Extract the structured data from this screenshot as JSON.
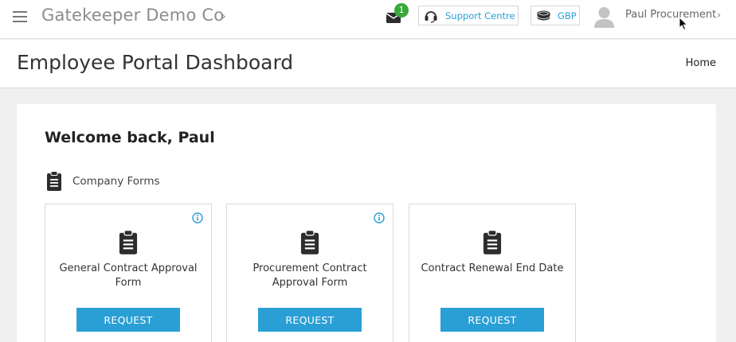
{
  "topbar": {
    "company": "Gatekeeper Demo Co",
    "notification_count": "1",
    "support_label": "Support Centre",
    "currency": "GBP",
    "user_name": "Paul Procurement"
  },
  "page": {
    "title": "Employee Portal Dashboard",
    "breadcrumb_home": "Home"
  },
  "main": {
    "welcome": "Welcome back, Paul",
    "section_label": "Company Forms",
    "forms": [
      {
        "title": "General Contract Approval Form",
        "button": "REQUEST",
        "has_info": true
      },
      {
        "title": "Procurement Contract Approval Form",
        "button": "REQUEST",
        "has_info": true
      },
      {
        "title": "Contract Renewal End Date",
        "button": "REQUEST",
        "has_info": false
      }
    ]
  },
  "colors": {
    "accent": "#2a9fd6",
    "badge": "#3aa83a",
    "link": "#2b9fd8"
  },
  "icons": [
    "menu-icon",
    "chevron-right-icon",
    "mail-icon",
    "headset-icon",
    "coins-icon",
    "user-avatar-icon",
    "clipboard-icon",
    "info-icon",
    "cursor-icon"
  ]
}
